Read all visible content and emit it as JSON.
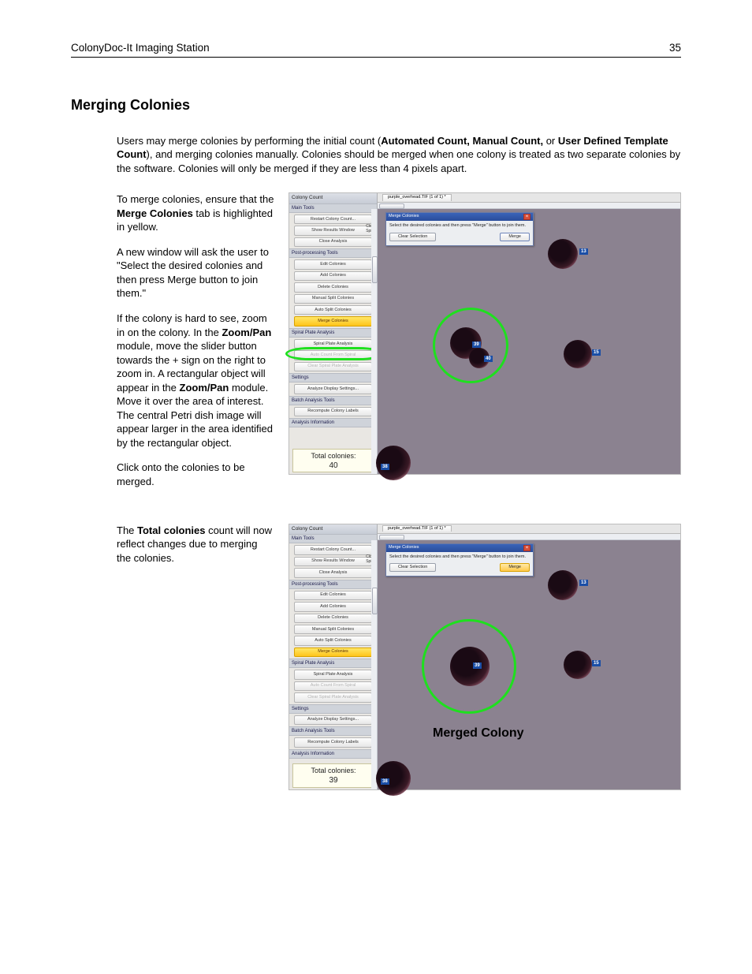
{
  "header": {
    "title": "ColonyDoc-It Imaging Station",
    "page": "35"
  },
  "section": {
    "title": "Merging Colonies"
  },
  "intro": {
    "t1a": "Users may merge colonies by performing the initial count (",
    "t1b": "Automated Count, Manual Count,",
    "t1c": " or ",
    "t1d": "User Defined Template Count",
    "t1e": "), and merging colonies manually.  Colonies should be merged when one colony is treated as two separate colonies by the software.  Colonies will only be merged if they are less than 4 pixels apart."
  },
  "para1": {
    "a": "To merge colonies, ensure that the ",
    "b": "Merge Colonies",
    "c": " tab is highlighted in yellow."
  },
  "para2": "A new window will ask the user to \"Select the desired colonies and then press Merge button to join them.\"",
  "para3": {
    "a": "If the colony is hard to see, zoom in on the colony.  In the ",
    "b": "Zoom/Pan",
    "c": " module, move the slider button towards the + sign on the right to zoom in.  A rectangular object will appear in the ",
    "d": "Zoom/Pan",
    "e": " module.  Move it over the area of interest.  The central Petri dish image will appear larger in the area identified by the rectangular object."
  },
  "para4": "Click onto the colonies to be merged.",
  "para5": {
    "a": "The ",
    "b": "Total colonies",
    "c": " count will now reflect changes due to merging the colonies."
  },
  "shot": {
    "window_title": "Colony Count",
    "tab_file": "purple_overhead.TIF (1 of 1) *",
    "sections": {
      "main": "Main Tools",
      "post": "Post-processing Tools",
      "spiral": "Spiral Plate Analysis",
      "settings": "Settings",
      "batch": "Batch Analysis Tools",
      "info": "Analysis Information"
    },
    "buttons": {
      "restart": "Restart Colony Count...",
      "show_results": "Show Results Window",
      "close_analysis": "Close Analysis",
      "edit": "Edit Colonies",
      "add": "Add Colonies",
      "delete": "Delete Colonies",
      "msplit": "Manual Split Colonies",
      "asplit": "Auto Split Colonies",
      "merge": "Merge Colonies",
      "spiral_an": "Spiral Plate Analysis",
      "auto_spiral": "Auto Count From Spiral",
      "clear_spiral": "Clear Spiral Plate Analysis",
      "disp": "Analyze Display Settings...",
      "recompute": "Recompute Colony Labels"
    },
    "close_spiral_label": "Close\nSpiral",
    "total_label": "Total colonies:",
    "dialog": {
      "title": "Merge Colonies",
      "msg": "Select the desired colonies and then press \"Merge\" button to join them.",
      "clear": "Clear Selection",
      "merge": "Merge"
    },
    "colony_labels": {
      "c13": "13",
      "c15": "15",
      "c38": "38",
      "c39": "39",
      "c40": "40"
    }
  },
  "shot1": {
    "total": "40"
  },
  "shot2": {
    "total": "39",
    "merged_caption": "Merged Colony"
  }
}
